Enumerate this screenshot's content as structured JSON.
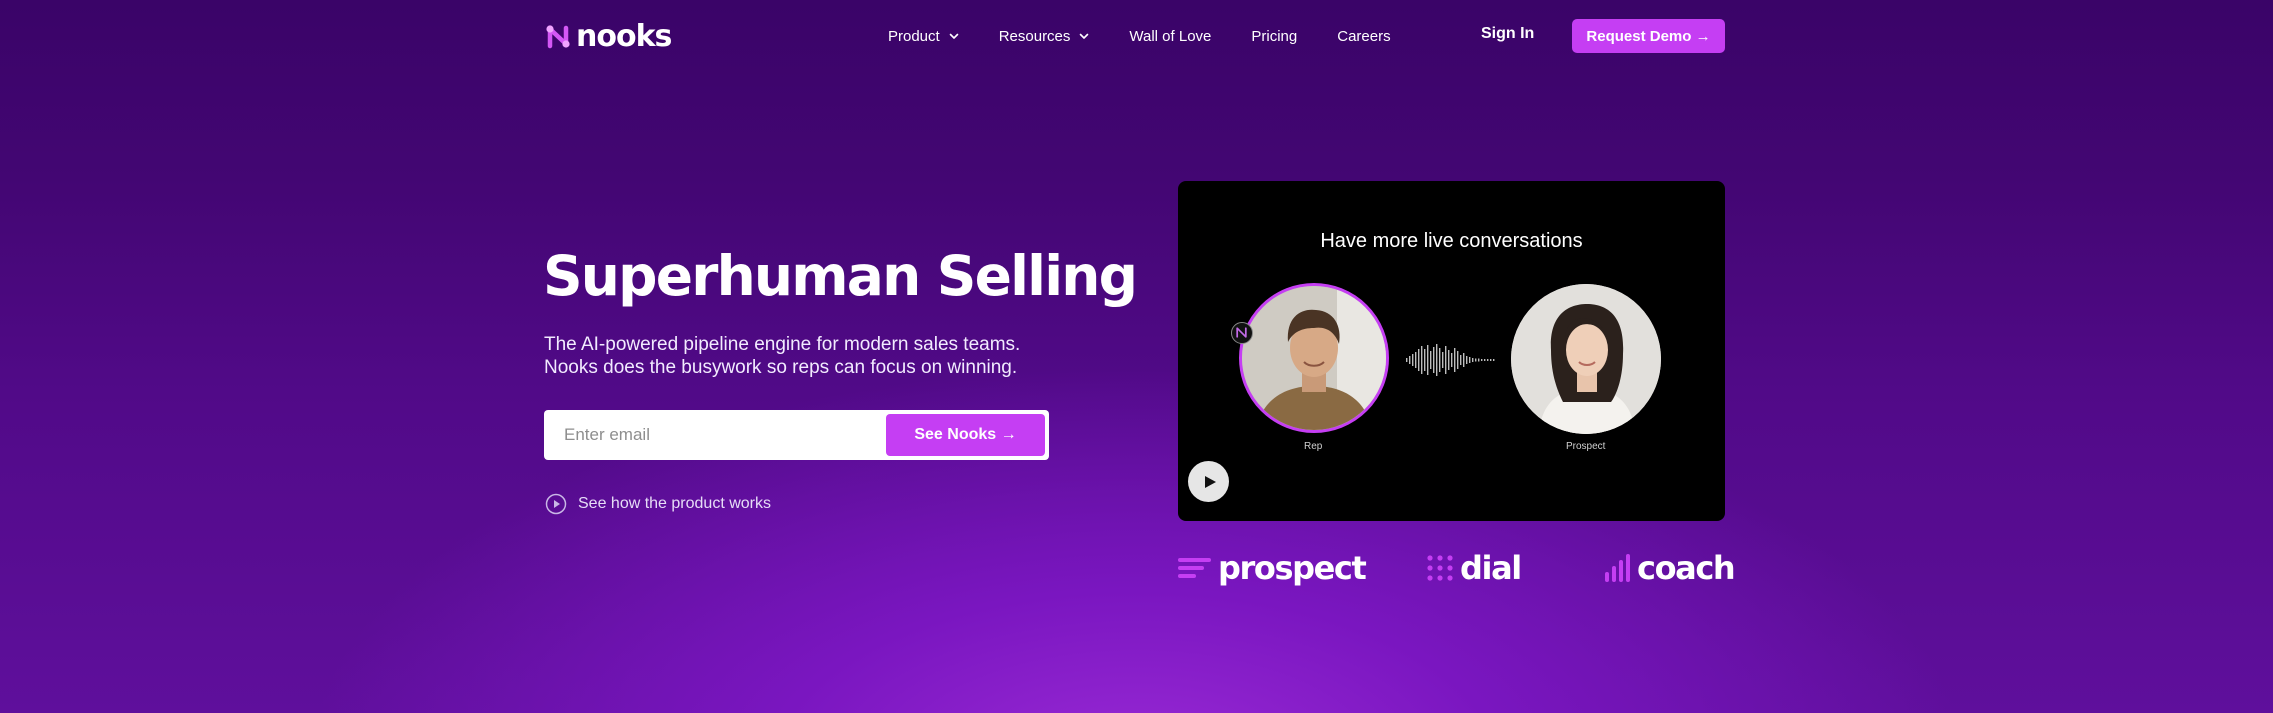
{
  "nav": {
    "logo_text": "nooks",
    "items": [
      {
        "label": "Product",
        "has_dropdown": true
      },
      {
        "label": "Resources",
        "has_dropdown": true
      },
      {
        "label": "Wall of Love",
        "has_dropdown": false
      },
      {
        "label": "Pricing",
        "has_dropdown": false
      },
      {
        "label": "Careers",
        "has_dropdown": false
      }
    ],
    "sign_in": "Sign In",
    "request_demo": "Request Demo →"
  },
  "hero": {
    "headline": "Superhuman Selling",
    "subtext_line1": "The AI-powered pipeline engine for modern sales teams.",
    "subtext_line2": "Nooks does the busywork so reps can focus on winning.",
    "email_placeholder": "Enter email",
    "cta": "See Nooks →",
    "howto": "See how the product works"
  },
  "video": {
    "title": "Have more live conversations",
    "rep_label": "Rep",
    "prospect_label": "Prospect"
  },
  "products": [
    {
      "name": "prospect",
      "icon": "prospect-lines-icon"
    },
    {
      "name": "dial",
      "icon": "dial-dots-icon"
    },
    {
      "name": "coach",
      "icon": "coach-bars-icon"
    }
  ],
  "colors": {
    "accent": "#c53ef3",
    "background_top": "#3a0468",
    "background_glow": "#9a2ad6"
  }
}
